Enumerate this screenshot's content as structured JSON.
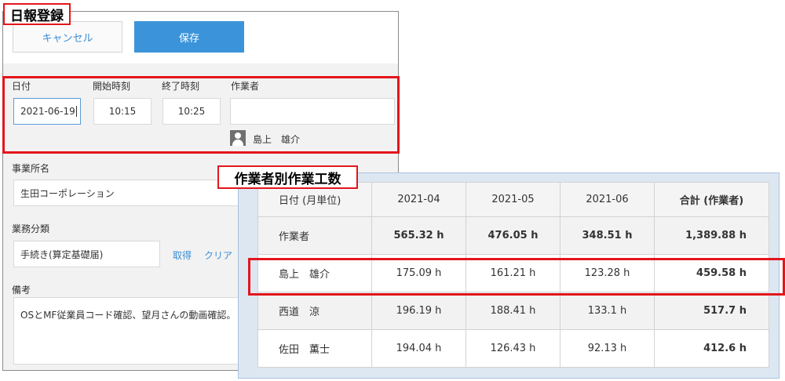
{
  "form": {
    "title": "日報登録",
    "cancel_label": "キャンセル",
    "save_label": "保存",
    "date_label": "日付",
    "date_value": "2021-06-19",
    "start_label": "開始時刻",
    "start_value": "10:15",
    "end_label": "終了時刻",
    "end_value": "10:25",
    "worker_label": "作業者",
    "worker_value": "",
    "worker_name": "島上　雄介",
    "office_label": "事業所名",
    "office_value": "生田コーポレーション",
    "category_label": "業務分類",
    "category_value": "手続き(算定基礎届)",
    "fetch_label": "取得",
    "clear_label": "クリア",
    "notes_label": "備考",
    "notes_value": "OSとMF従業員コード確認、望月さんの動画確認。"
  },
  "table": {
    "title": "作業者別作業工数",
    "headers": [
      "日付 (月単位)",
      "2021-04",
      "2021-05",
      "2021-06",
      "合計 (作業者)"
    ],
    "rows": [
      {
        "label": "作業者",
        "values": [
          "565.32 h",
          "476.05 h",
          "348.51 h",
          "1,389.88 h"
        ]
      },
      {
        "label": "島上　雄介",
        "values": [
          "175.09 h",
          "161.21 h",
          "123.28 h",
          "459.58 h"
        ]
      },
      {
        "label": "西道　涼",
        "values": [
          "196.19 h",
          "188.41 h",
          "133.1 h",
          "517.7 h"
        ]
      },
      {
        "label": "佐田　薫士",
        "values": [
          "194.04 h",
          "126.43 h",
          "92.13 h",
          "412.6 h"
        ]
      }
    ]
  },
  "colors": {
    "highlight": "#e3161b",
    "primary_button": "#3b94d9",
    "link": "#3a8ed8"
  },
  "icons": {
    "worker_avatar": "person-icon"
  }
}
